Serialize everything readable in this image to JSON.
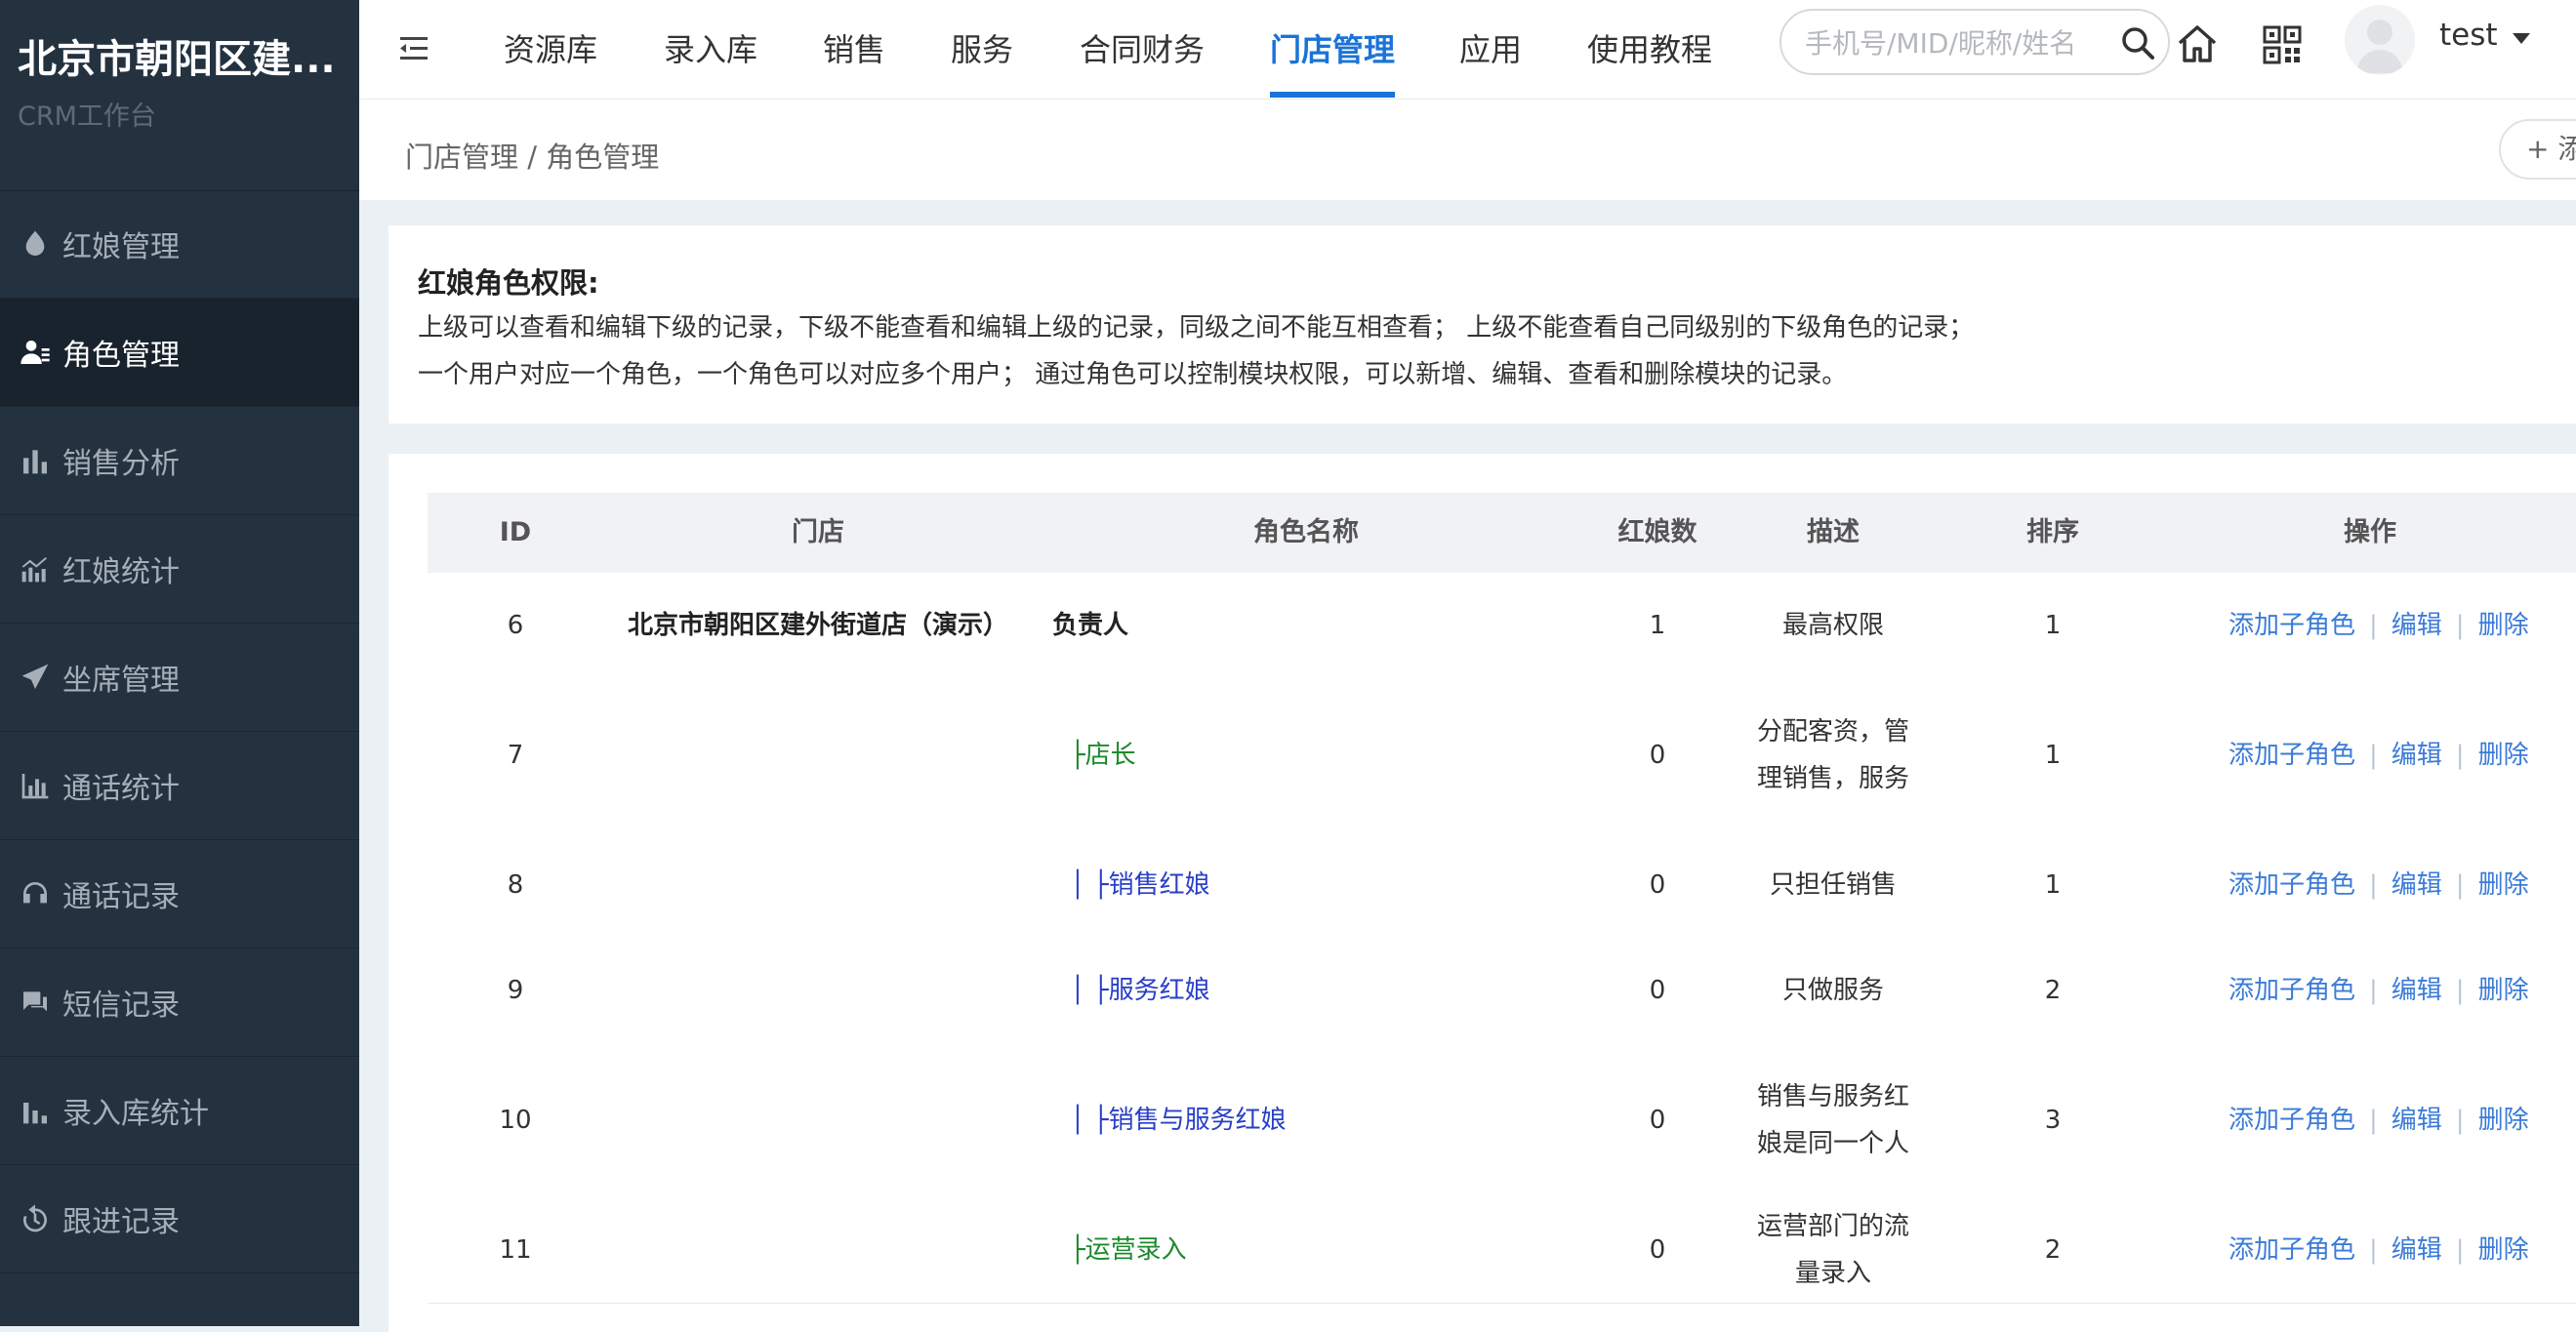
{
  "brand": {
    "title": "北京市朝阳区建...",
    "subtitle": "CRM工作台"
  },
  "sidebar": {
    "items": [
      {
        "label": "红娘管理",
        "icon": "drop-icon",
        "active": false
      },
      {
        "label": "角色管理",
        "icon": "user-list-icon",
        "active": true
      },
      {
        "label": "销售分析",
        "icon": "bar-chart-icon",
        "active": false
      },
      {
        "label": "红娘统计",
        "icon": "trend-chart-icon",
        "active": false
      },
      {
        "label": "坐席管理",
        "icon": "paper-plane-icon",
        "active": false
      },
      {
        "label": "通话统计",
        "icon": "bar-chart-icon",
        "active": false
      },
      {
        "label": "通话记录",
        "icon": "headset-icon",
        "active": false
      },
      {
        "label": "短信记录",
        "icon": "chat-icon",
        "active": false
      },
      {
        "label": "录入库统计",
        "icon": "bar-chart-icon",
        "active": false
      },
      {
        "label": "跟进记录",
        "icon": "history-icon",
        "active": false
      }
    ]
  },
  "topnav": {
    "tabs": [
      {
        "label": "资源库"
      },
      {
        "label": "录入库"
      },
      {
        "label": "销售"
      },
      {
        "label": "服务"
      },
      {
        "label": "合同财务"
      },
      {
        "label": "门店管理",
        "active": true
      },
      {
        "label": "应用"
      },
      {
        "label": "使用教程"
      }
    ],
    "search_placeholder": "手机号/MID/昵称/姓名",
    "search_value": "",
    "user_name": "test"
  },
  "breadcrumb": {
    "text": "门店管理 / 角色管理"
  },
  "add_button": {
    "label": "+ 添"
  },
  "info": {
    "title": "红娘角色权限:",
    "line1": "上级可以查看和编辑下级的记录，下级不能查看和编辑上级的记录，同级之间不能互相查看； 上级不能查看自己同级别的下级角色的记录；",
    "line2": "一个用户对应一个角色，一个角色可以对应多个用户； 通过角色可以控制模块权限，可以新增、编辑、查看和删除模块的记录。"
  },
  "table": {
    "columns": [
      "ID",
      "门店",
      "角色名称",
      "红娘数",
      "描述",
      "排序",
      "操作"
    ],
    "actions": {
      "add_child": "添加子角色",
      "edit": "编辑",
      "delete": "删除",
      "sep": "|"
    },
    "rows": [
      {
        "id": "6",
        "store": "北京市朝阳区建外街道店（演示）",
        "role": "负责人",
        "count": "1",
        "desc": "最高权限",
        "sort": "1"
      },
      {
        "id": "7",
        "store": "",
        "role": "├店长",
        "count": "0",
        "desc": "分配客资，管理销售，服务",
        "sort": "1"
      },
      {
        "id": "8",
        "store": "",
        "role": "│ ├销售红娘",
        "count": "0",
        "desc": "只担任销售",
        "sort": "1"
      },
      {
        "id": "9",
        "store": "",
        "role": "│ ├服务红娘",
        "count": "0",
        "desc": "只做服务",
        "sort": "2"
      },
      {
        "id": "10",
        "store": "",
        "role": "│ ├销售与服务红娘",
        "count": "0",
        "desc": "销售与服务红娘是同一个人",
        "sort": "3"
      },
      {
        "id": "11",
        "store": "",
        "role": "├运营录入",
        "count": "0",
        "desc": "运营部门的流量录入",
        "sort": "2"
      }
    ]
  },
  "colors": {
    "accent": "#1a73d8",
    "sidebar_bg": "#243240",
    "link": "#3b7bd8",
    "role_level1": "#1d8a2c",
    "role_level2": "#2a3fc8"
  }
}
